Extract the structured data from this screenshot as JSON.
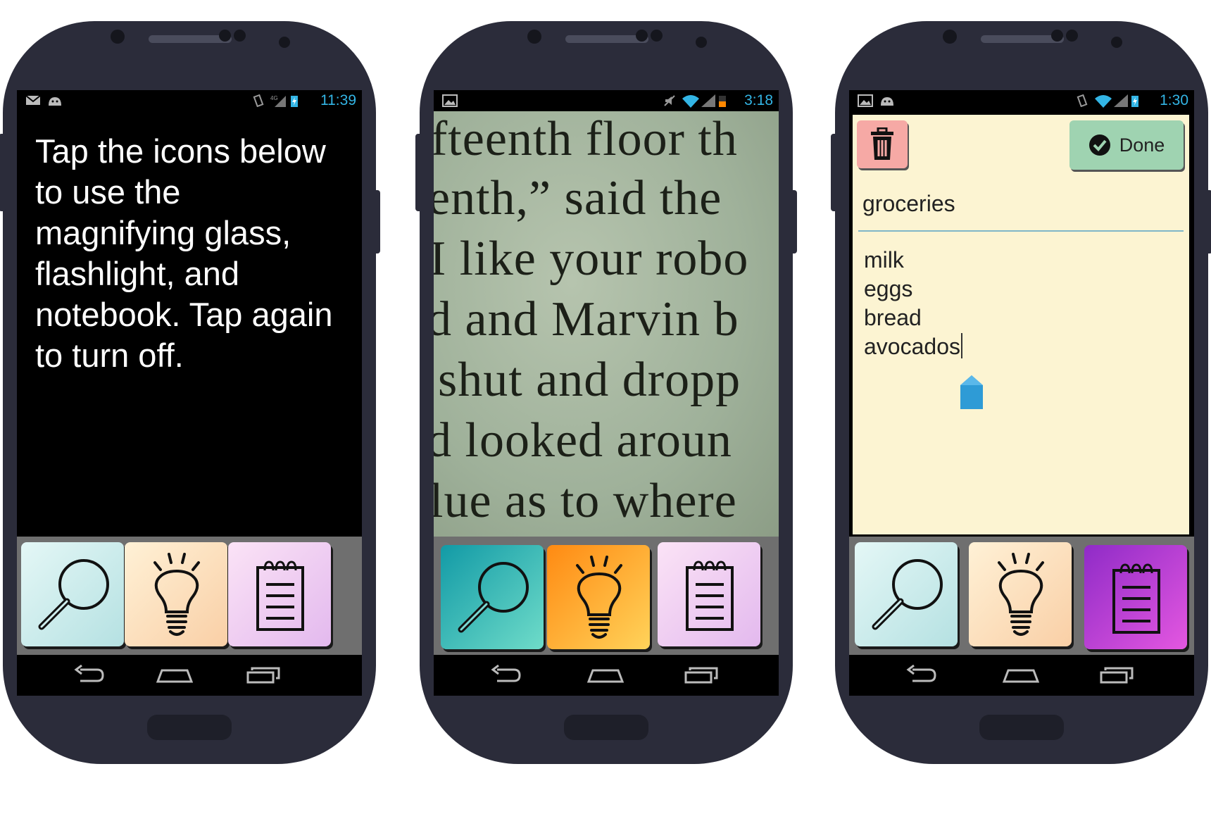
{
  "phones": [
    {
      "status": {
        "icons": [
          "gmail-icon",
          "android-icon",
          "vibrate-icon",
          "4g-signal-icon",
          "battery-charging-icon"
        ],
        "time": "11:39"
      },
      "instruction": "Tap the icons below to use the magnifying glass, flashlight, and notebook. Tap again to turn off.",
      "toolbar": {
        "magnifier": "inactive",
        "flashlight": "inactive",
        "notebook": "inactive"
      }
    },
    {
      "status": {
        "icons": [
          "image-icon",
          "mute-icon",
          "wifi-icon",
          "signal-icon",
          "battery-low-icon"
        ],
        "time": "3:18"
      },
      "book_lines": [
        "fteenth floor th",
        "enth,”  said  the",
        "I  like your robo",
        "d and Marvin b",
        "shut and dropp",
        "d looked aroun",
        "lue as to where"
      ],
      "toolbar": {
        "magnifier": "active",
        "flashlight": "active",
        "notebook": "inactive"
      }
    },
    {
      "status": {
        "icons": [
          "image-icon",
          "android-icon",
          "vibrate-icon",
          "wifi-icon",
          "signal-icon",
          "battery-charging-icon"
        ],
        "time": "1:30"
      },
      "note": {
        "done_label": "Done",
        "title": "groceries",
        "items": [
          "milk",
          "eggs",
          "bread",
          "avocados"
        ]
      },
      "toolbar": {
        "magnifier": "inactive",
        "flashlight": "inactive",
        "notebook": "active"
      }
    }
  ],
  "colors": {
    "accent_clock": "#33b5e5",
    "magnifier_inactive": [
      "#e4f7f6",
      "#b5e1e2"
    ],
    "magnifier_active": [
      "#129aa6",
      "#6fdcc9"
    ],
    "flashlight_inactive": [
      "#fff1d6",
      "#f9cfa6"
    ],
    "flashlight_active": [
      "#ff8a12",
      "#ffd35a"
    ],
    "notebook_inactive": [
      "#fbe3f6",
      "#e3b9ee"
    ],
    "notebook_active": [
      "#8f2bc7",
      "#e457e0"
    ]
  }
}
